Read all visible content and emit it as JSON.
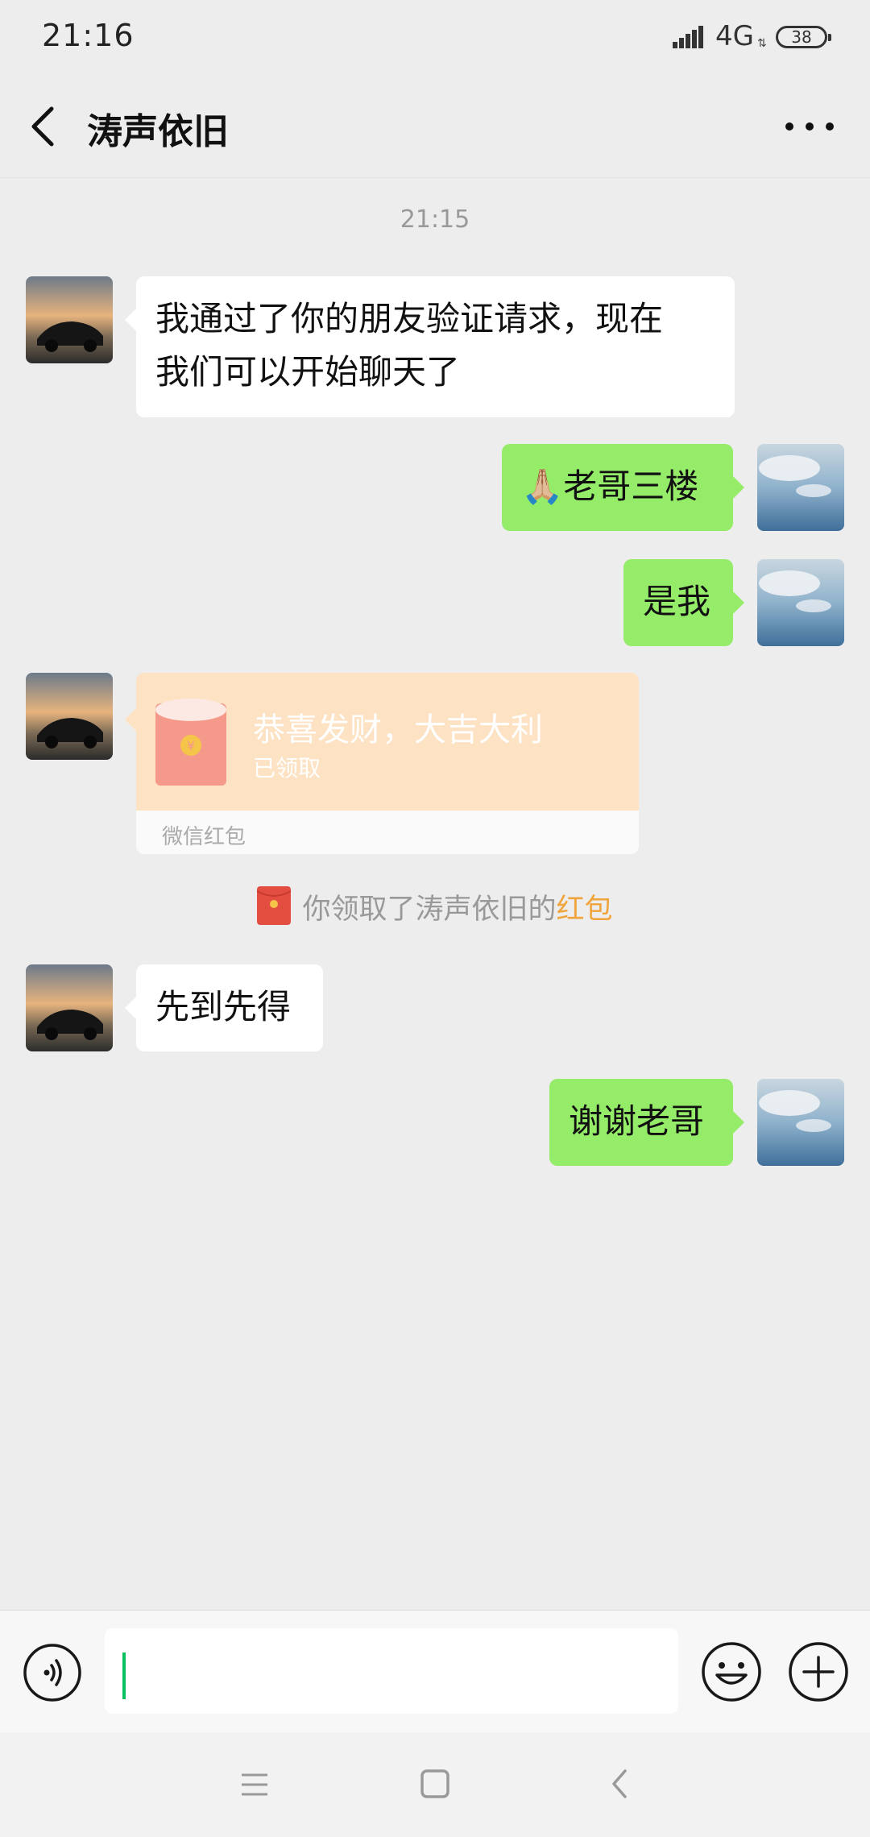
{
  "status_bar": {
    "time": "21:16",
    "network": "4G",
    "battery": "38"
  },
  "header": {
    "title": "涛声依旧"
  },
  "messages": {
    "time_separator": "21:15",
    "msg1": {
      "text_line1": "我通过了你的朋友验证请求，现在",
      "text_line2": "我们可以开始聊天了"
    },
    "msg2": {
      "emoji": "🙏🏼",
      "text": "老哥三楼"
    },
    "msg3": {
      "text": "是我"
    },
    "red_packet": {
      "title": "恭喜发财，大吉大利",
      "status": "已领取",
      "footer": "微信红包"
    },
    "system": {
      "text": "你领取了涛声依旧的",
      "link": "红包"
    },
    "msg5": {
      "text": "先到先得"
    },
    "msg6": {
      "text": "谢谢老哥"
    }
  },
  "colors": {
    "chat_bg": "#ededed",
    "sent_bubble": "#95ec69",
    "received_bubble": "#ffffff",
    "red_packet_bg": "#fde2c4",
    "link": "#f0a43c",
    "caret": "#07c160"
  }
}
